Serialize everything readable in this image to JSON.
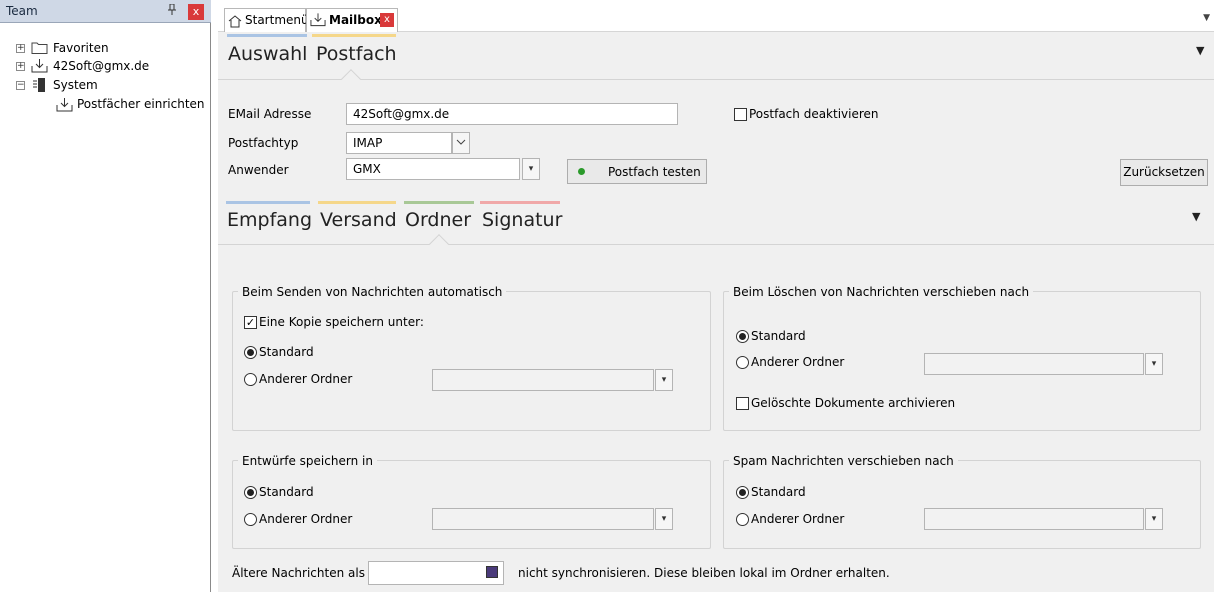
{
  "left_panel": {
    "title": "Team",
    "pin_icon": "pin-icon",
    "close_label": "x",
    "tree": [
      {
        "label": "Favoriten",
        "icon": "folder-icon",
        "expander": "+"
      },
      {
        "label": "42Soft@gmx.de",
        "icon": "inbox-icon",
        "expander": "+"
      },
      {
        "label": "System",
        "icon": "server-icon",
        "expander": "−"
      },
      {
        "label": "Postfächer einrichten",
        "icon": "inbox-icon"
      }
    ]
  },
  "tabs": {
    "items": [
      {
        "label": "Startmenü",
        "icon": "home-icon"
      },
      {
        "label": "Mailbox",
        "icon": "inbox-icon",
        "close_label": "x"
      }
    ]
  },
  "top_sections": {
    "tabs": [
      {
        "label": "Auswahl",
        "color": "#aac4e4"
      },
      {
        "label": "Postfach",
        "color": "#f5d78a"
      }
    ]
  },
  "form": {
    "email_label": "EMail Adresse",
    "email_value": "42Soft@gmx.de",
    "type_label": "Postfachtyp",
    "type_value": "IMAP",
    "user_label": "Anwender",
    "user_value": "GMX",
    "test_button": "Postfach testen",
    "deactivate_label": "Postfach deaktivieren",
    "reset_button": "Zurücksetzen"
  },
  "sub_sections": {
    "tabs": [
      {
        "label": "Empfang",
        "color": "#aac4e4"
      },
      {
        "label": "Versand",
        "color": "#f5d78a"
      },
      {
        "label": "Ordner",
        "color": "#a8c896"
      },
      {
        "label": "Signatur",
        "color": "#f0a8a8"
      }
    ]
  },
  "groups": {
    "send": {
      "title": "Beim Senden von Nachrichten automatisch",
      "copy_label": "Eine Kopie speichern unter:",
      "copy_checked": true,
      "standard_label": "Standard",
      "other_label": "Anderer Ordner"
    },
    "delete": {
      "title": "Beim Löschen von Nachrichten verschieben nach",
      "standard_label": "Standard",
      "other_label": "Anderer Ordner",
      "archive_label": "Gelöschte Dokumente archivieren",
      "archive_checked": false
    },
    "drafts": {
      "title": "Entwürfe speichern in",
      "standard_label": "Standard",
      "other_label": "Anderer Ordner"
    },
    "spam": {
      "title": "Spam Nachrichten verschieben nach",
      "standard_label": "Standard",
      "other_label": "Anderer Ordner"
    }
  },
  "footer": {
    "older_label": "Ältere Nachrichten als",
    "older_value": "",
    "suffix_text": "nicht synchronisieren. Diese bleiben lokal im Ordner erhalten."
  }
}
